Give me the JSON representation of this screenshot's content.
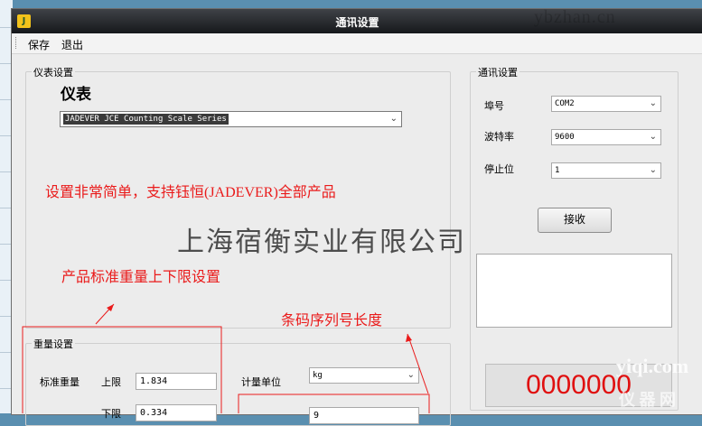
{
  "window": {
    "title": "通讯设置",
    "app_icon": "J"
  },
  "menu": {
    "items": [
      "保存",
      "退出"
    ]
  },
  "meter": {
    "group_title": "仪表设置",
    "heading": "仪表",
    "model": "JADEVER JCE Counting Scale Series"
  },
  "comm": {
    "group_title": "通讯设置",
    "port_label": "埠号",
    "port_value": "COM2",
    "baud_label": "波特率",
    "baud_value": "9600",
    "stop_label": "停止位",
    "stop_value": "1",
    "receive_button": "接收",
    "display_value": "0000000"
  },
  "weight": {
    "group_title": "重量设置",
    "standard_label": "标准重量",
    "upper_label": "上限",
    "upper_value": "1.834",
    "lower_label": "下限",
    "lower_value": "0.334",
    "unit_label": "计量单位",
    "unit_value": "kg",
    "barcode_value": "9"
  },
  "annotations": {
    "note1": "设置非常简单，支持钰恒(JADEVER)全部产品",
    "note2": "产品标准重量上下限设置",
    "note3": "条码序列号长度",
    "company": "上海宿衡实业有限公司"
  },
  "watermarks": {
    "top": "ybzhan.cn",
    "bottom": "yiqi.com",
    "bottom_cn": "仪 器 网"
  },
  "colors": {
    "annotation": "#ea1b1b",
    "display_digits": "#e01010",
    "titlebar": "#16181b"
  },
  "icons": {
    "app": "app-logo-icon",
    "dropdown": "chevron-down-icon"
  }
}
